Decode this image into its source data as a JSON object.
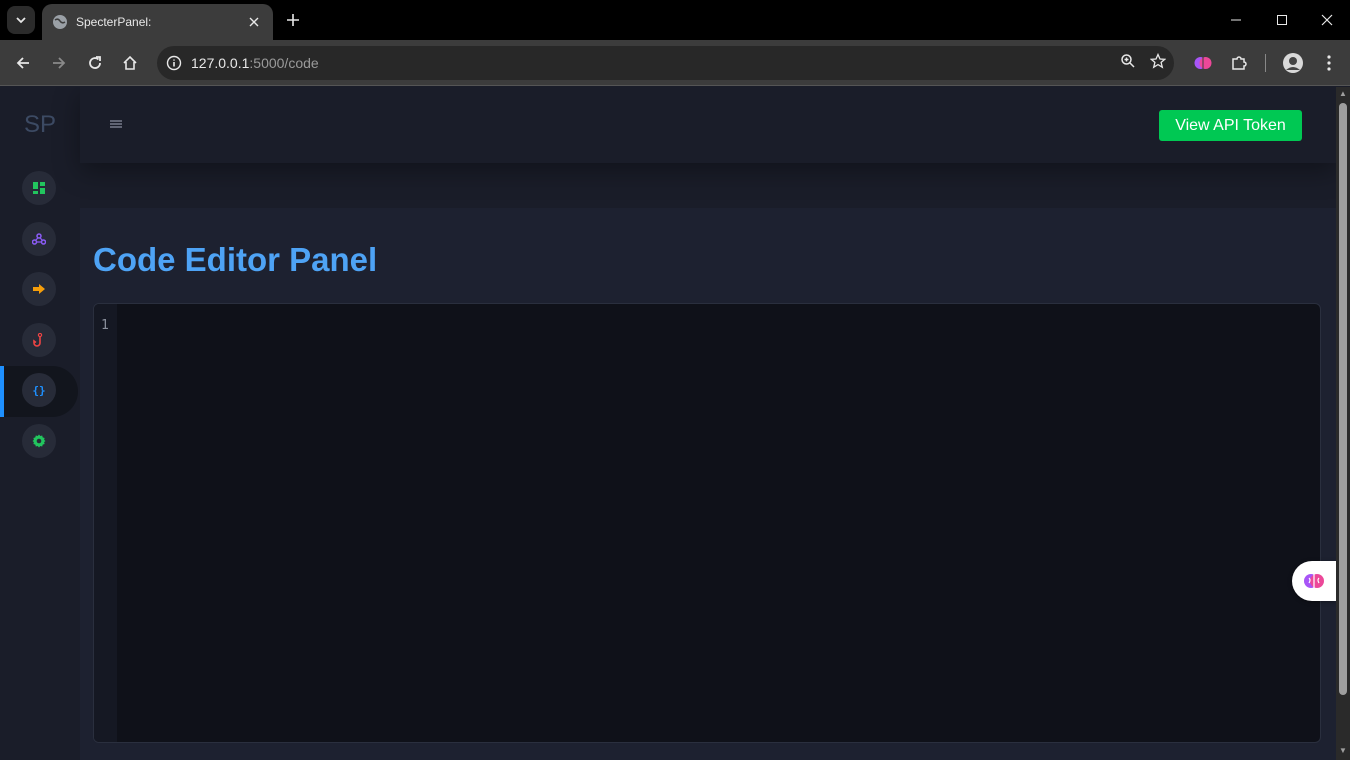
{
  "browser": {
    "tab_title": "SpecterPanel:",
    "url_host": "127.0.0.1",
    "url_rest": ":5000/code"
  },
  "app": {
    "logo": "SP",
    "api_button": "View API Token",
    "page_title": "Code Editor Panel",
    "editor_line_numbers": [
      "1"
    ]
  },
  "sidebar": {
    "items": [
      {
        "icon": "dashboard-icon",
        "color": "#22c55e"
      },
      {
        "icon": "webhook-icon",
        "color": "#8b5cf6"
      },
      {
        "icon": "arrow-right-icon",
        "color": "#f59e0b"
      },
      {
        "icon": "hook-icon",
        "color": "#ef4444"
      },
      {
        "icon": "code-braces-icon",
        "color": "#1e90ff",
        "active": true
      },
      {
        "icon": "gear-icon",
        "color": "#22c55e"
      }
    ]
  },
  "colors": {
    "accent": "#1e90ff",
    "button": "#00c853",
    "title": "#4ea3f5"
  }
}
